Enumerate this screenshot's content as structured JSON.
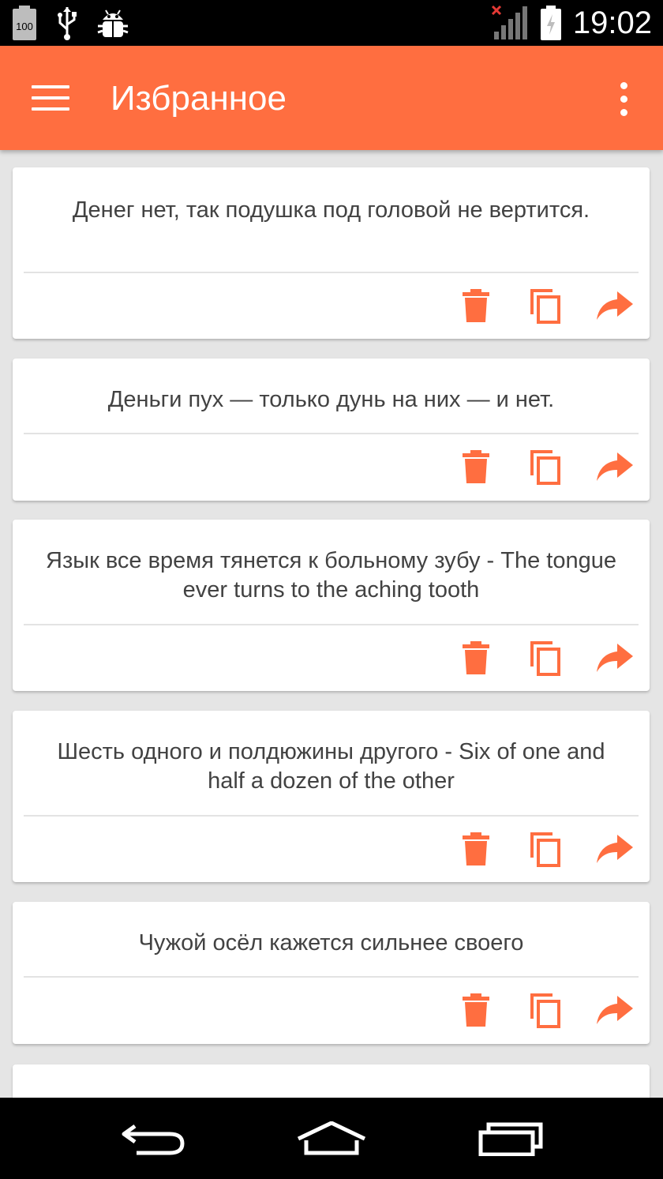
{
  "status_bar": {
    "battery_level": "100",
    "time": "19:02",
    "icons": [
      "battery-icon",
      "usb-icon",
      "android-debug-icon",
      "signal-no-service-icon",
      "battery-charging-icon"
    ]
  },
  "app_bar": {
    "title": "Избранное",
    "menu_icon": "hamburger-menu-icon",
    "overflow_icon": "more-vert-icon"
  },
  "theme": {
    "accent": "#ff6e40",
    "background": "#e5e5e5",
    "text": "#424242"
  },
  "cards": [
    {
      "text": "Денег нет, так подушка под головой не вертится."
    },
    {
      "text": "Деньги пух — только дунь на них — и нет."
    },
    {
      "text": "Язык все время тянется к больному зубу - The tongue ever turns to the aching tooth"
    },
    {
      "text": "Шесть одного и полдюжины другого - Six of one and half a dozen of the other"
    },
    {
      "text": "Чужой осёл кажется сильнее своего"
    },
    {
      "text": ""
    }
  ],
  "card_actions": [
    "delete-icon",
    "copy-icon",
    "share-icon"
  ],
  "nav_bar": {
    "icons": [
      "back-icon",
      "home-icon",
      "recents-icon"
    ]
  }
}
